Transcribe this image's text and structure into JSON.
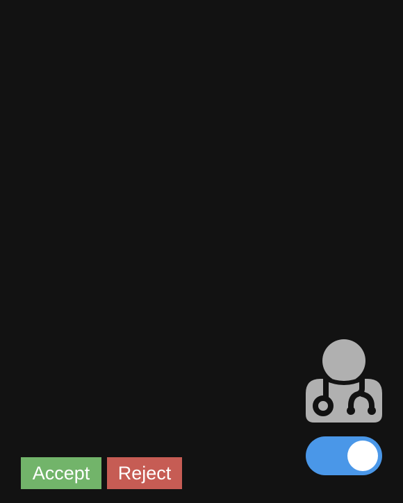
{
  "avatar": {
    "icon": "doctor-stethoscope-icon",
    "color": "#b0b0b0"
  },
  "toggle": {
    "state": "on",
    "on_color": "#4a97e8"
  },
  "actions": {
    "accept_label": "Accept",
    "accept_color": "#72b46a",
    "reject_label": "Reject",
    "reject_color": "#c65c54"
  },
  "colors": {
    "background": "#121212"
  }
}
